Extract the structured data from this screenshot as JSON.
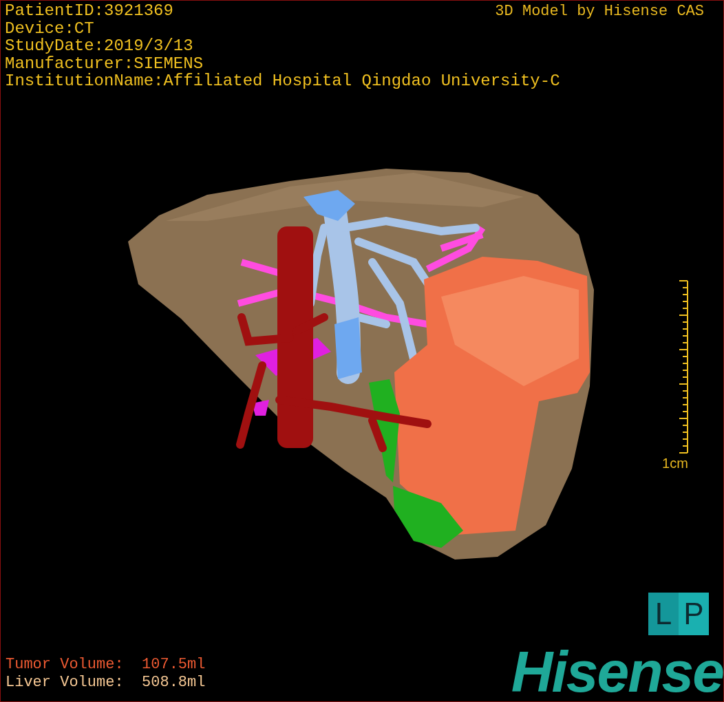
{
  "info": [
    "PatientID:3921369",
    "Device:CT",
    "StudyDate:2019/3/13",
    "Manufacturer:SIEMENS",
    "InstitutionName:Affiliated Hospital Qingdao University-C"
  ],
  "title": "3D Model by Hisense CAS",
  "scale": {
    "label": "1cm"
  },
  "orientation": [
    "L",
    "P"
  ],
  "volumes": [
    {
      "kind": "tumor",
      "label": "Tumor Volume:",
      "value": "107.5ml"
    },
    {
      "kind": "liver",
      "label": "Liver Volume:",
      "value": "508.8ml"
    }
  ],
  "logo": "Hisense"
}
